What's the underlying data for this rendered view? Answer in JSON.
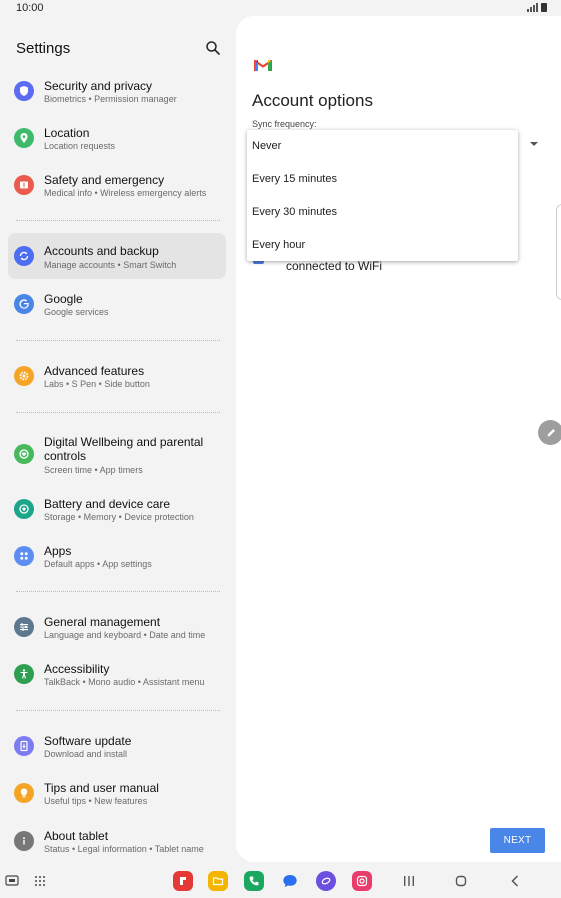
{
  "status_bar": {
    "time": "10:00"
  },
  "settings": {
    "title": "Settings",
    "items": [
      {
        "title": "Security and privacy",
        "subtitle": "Biometrics  •  Permission manager",
        "icon": "shield-icon",
        "color": "#5c6bf0"
      },
      {
        "title": "Location",
        "subtitle": "Location requests",
        "icon": "location-pin-icon",
        "color": "#3fb96a"
      },
      {
        "title": "Safety and emergency",
        "subtitle": "Medical info  •  Wireless emergency alerts",
        "icon": "emergency-icon",
        "color": "#ea5a4f"
      },
      {
        "title": "Accounts and backup",
        "subtitle": "Manage accounts  •  Smart Switch",
        "icon": "sync-icon",
        "color": "#4d6ef0"
      },
      {
        "title": "Google",
        "subtitle": "Google services",
        "icon": "google-icon",
        "color": "#4a86e8"
      },
      {
        "title": "Advanced features",
        "subtitle": "Labs  •  S Pen  •  Side button",
        "icon": "gear-plus-icon",
        "color": "#f4a526"
      },
      {
        "title": "Digital Wellbeing and parental controls",
        "subtitle": "Screen time  •  App timers",
        "icon": "wellbeing-icon",
        "color": "#49b85c"
      },
      {
        "title": "Battery and device care",
        "subtitle": "Storage  •  Memory  •  Device protection",
        "icon": "device-care-icon",
        "color": "#1ba68a"
      },
      {
        "title": "Apps",
        "subtitle": "Default apps  •  App settings",
        "icon": "apps-grid-icon",
        "color": "#5b8ef0"
      },
      {
        "title": "General management",
        "subtitle": "Language and keyboard  •  Date and time",
        "icon": "sliders-icon",
        "color": "#5e7890"
      },
      {
        "title": "Accessibility",
        "subtitle": "TalkBack  •  Mono audio  •  Assistant menu",
        "icon": "accessibility-icon",
        "color": "#2f9e50"
      },
      {
        "title": "Software update",
        "subtitle": "Download and install",
        "icon": "software-update-icon",
        "color": "#7b7cf0"
      },
      {
        "title": "Tips and user manual",
        "subtitle": "Useful tips  •  New features",
        "icon": "lightbulb-icon",
        "color": "#f4a526"
      },
      {
        "title": "About tablet",
        "subtitle": "Status  •  Legal information  •  Tablet name",
        "icon": "info-icon",
        "color": "#777777"
      }
    ]
  },
  "account_options": {
    "title": "Account options",
    "sync_label": "Sync frequency:",
    "wifi_text": "connected to WiFi",
    "next_label": "NEXT"
  },
  "dropdown": {
    "options": [
      "Never",
      "Every 15 minutes",
      "Every 30 minutes",
      "Every hour"
    ]
  },
  "navbar": {
    "apps": [
      {
        "name": "flipboard-app-icon",
        "color": "#e53935"
      },
      {
        "name": "my-files-app-icon",
        "color": "#f4b400"
      },
      {
        "name": "phone-app-icon",
        "color": "#1ba760"
      },
      {
        "name": "messages-app-icon",
        "color": "#2a6ff0"
      },
      {
        "name": "internet-app-icon",
        "color": "#6a4fe0"
      },
      {
        "name": "camera-app-icon",
        "color": "#e83d6b"
      }
    ]
  }
}
